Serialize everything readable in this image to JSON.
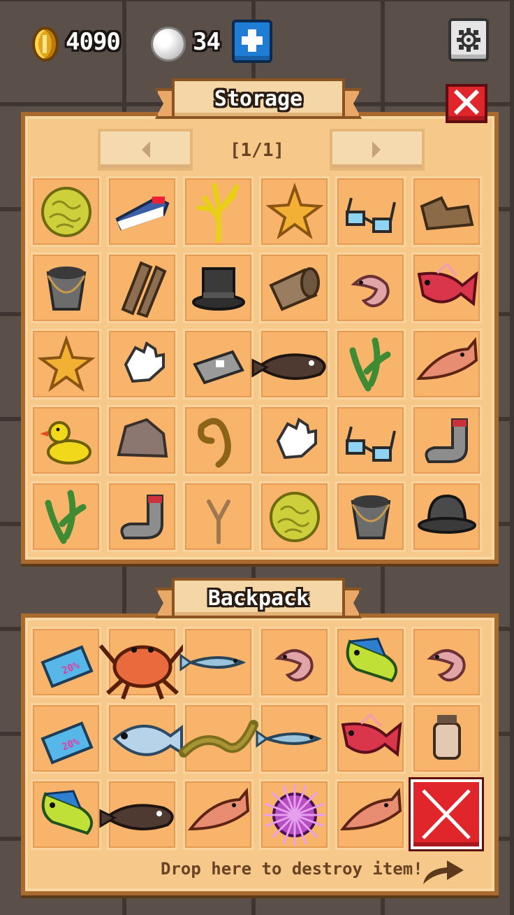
{
  "hud": {
    "coins": "4090",
    "pearls": "34"
  },
  "storage": {
    "title": "Storage",
    "page_label": "[1/1]",
    "items": [
      {
        "icon": "coral-ball-icon"
      },
      {
        "icon": "sneaker-icon"
      },
      {
        "icon": "yellow-coral-icon"
      },
      {
        "icon": "starfish-icon"
      },
      {
        "icon": "glasses-icon"
      },
      {
        "icon": "old-boot-icon"
      },
      {
        "icon": "bucket-icon"
      },
      {
        "icon": "wooden-planks-icon"
      },
      {
        "icon": "top-hat-icon"
      },
      {
        "icon": "barrel-icon"
      },
      {
        "icon": "shrimp-icon"
      },
      {
        "icon": "red-snapper-icon"
      },
      {
        "icon": "starfish-icon"
      },
      {
        "icon": "glove-icon"
      },
      {
        "icon": "tin-can-icon"
      },
      {
        "icon": "flounder-icon"
      },
      {
        "icon": "seaweed-icon"
      },
      {
        "icon": "trout-icon"
      },
      {
        "icon": "rubber-duck-icon"
      },
      {
        "icon": "rock-icon"
      },
      {
        "icon": "rope-icon"
      },
      {
        "icon": "glove-icon"
      },
      {
        "icon": "glasses-icon"
      },
      {
        "icon": "sock-icon"
      },
      {
        "icon": "seaweed-icon"
      },
      {
        "icon": "sock-icon"
      },
      {
        "icon": "slingshot-stick-icon"
      },
      {
        "icon": "coral-ball-icon"
      },
      {
        "icon": "bucket-icon"
      },
      {
        "icon": "bowler-hat-icon"
      }
    ]
  },
  "backpack": {
    "title": "Backpack",
    "items": [
      {
        "icon": "ticket-icon"
      },
      {
        "icon": "crab-icon"
      },
      {
        "icon": "sardine-icon"
      },
      {
        "icon": "shrimp-icon"
      },
      {
        "icon": "mahi-mahi-icon"
      },
      {
        "icon": "shrimp-icon"
      },
      {
        "icon": "ticket-icon"
      },
      {
        "icon": "bluegill-icon"
      },
      {
        "icon": "eel-icon"
      },
      {
        "icon": "sardine-icon"
      },
      {
        "icon": "red-snapper-icon"
      },
      {
        "icon": "jar-icon"
      },
      {
        "icon": "mahi-mahi-icon"
      },
      {
        "icon": "flounder-icon"
      },
      {
        "icon": "trout-icon"
      },
      {
        "icon": "sea-urchin-icon"
      },
      {
        "icon": "trout-icon"
      },
      {
        "icon": "empty"
      }
    ],
    "destroy_hint": "Drop here to destroy item!"
  },
  "colors": {
    "panel": "#f6c98b",
    "slot": "#f9b46b",
    "danger": "#e0262b",
    "accent_blue": "#1f7dd6"
  }
}
